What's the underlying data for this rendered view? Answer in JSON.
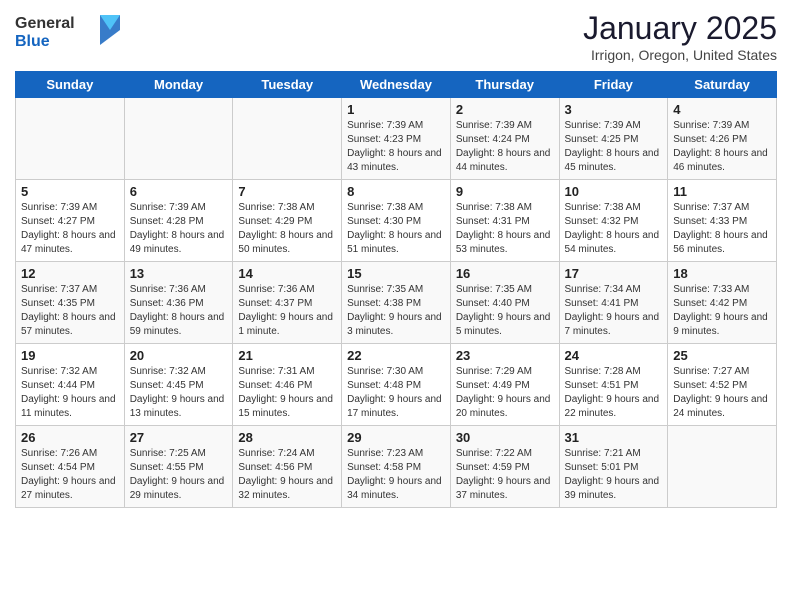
{
  "header": {
    "logo_general": "General",
    "logo_blue": "Blue",
    "month": "January 2025",
    "location": "Irrigon, Oregon, United States"
  },
  "days_of_week": [
    "Sunday",
    "Monday",
    "Tuesday",
    "Wednesday",
    "Thursday",
    "Friday",
    "Saturday"
  ],
  "weeks": [
    [
      {
        "day": "",
        "sunrise": "",
        "sunset": "",
        "daylight": "",
        "empty": true
      },
      {
        "day": "",
        "sunrise": "",
        "sunset": "",
        "daylight": "",
        "empty": true
      },
      {
        "day": "",
        "sunrise": "",
        "sunset": "",
        "daylight": "",
        "empty": true
      },
      {
        "day": "1",
        "sunrise": "Sunrise: 7:39 AM",
        "sunset": "Sunset: 4:23 PM",
        "daylight": "Daylight: 8 hours and 43 minutes."
      },
      {
        "day": "2",
        "sunrise": "Sunrise: 7:39 AM",
        "sunset": "Sunset: 4:24 PM",
        "daylight": "Daylight: 8 hours and 44 minutes."
      },
      {
        "day": "3",
        "sunrise": "Sunrise: 7:39 AM",
        "sunset": "Sunset: 4:25 PM",
        "daylight": "Daylight: 8 hours and 45 minutes."
      },
      {
        "day": "4",
        "sunrise": "Sunrise: 7:39 AM",
        "sunset": "Sunset: 4:26 PM",
        "daylight": "Daylight: 8 hours and 46 minutes."
      }
    ],
    [
      {
        "day": "5",
        "sunrise": "Sunrise: 7:39 AM",
        "sunset": "Sunset: 4:27 PM",
        "daylight": "Daylight: 8 hours and 47 minutes."
      },
      {
        "day": "6",
        "sunrise": "Sunrise: 7:39 AM",
        "sunset": "Sunset: 4:28 PM",
        "daylight": "Daylight: 8 hours and 49 minutes."
      },
      {
        "day": "7",
        "sunrise": "Sunrise: 7:38 AM",
        "sunset": "Sunset: 4:29 PM",
        "daylight": "Daylight: 8 hours and 50 minutes."
      },
      {
        "day": "8",
        "sunrise": "Sunrise: 7:38 AM",
        "sunset": "Sunset: 4:30 PM",
        "daylight": "Daylight: 8 hours and 51 minutes."
      },
      {
        "day": "9",
        "sunrise": "Sunrise: 7:38 AM",
        "sunset": "Sunset: 4:31 PM",
        "daylight": "Daylight: 8 hours and 53 minutes."
      },
      {
        "day": "10",
        "sunrise": "Sunrise: 7:38 AM",
        "sunset": "Sunset: 4:32 PM",
        "daylight": "Daylight: 8 hours and 54 minutes."
      },
      {
        "day": "11",
        "sunrise": "Sunrise: 7:37 AM",
        "sunset": "Sunset: 4:33 PM",
        "daylight": "Daylight: 8 hours and 56 minutes."
      }
    ],
    [
      {
        "day": "12",
        "sunrise": "Sunrise: 7:37 AM",
        "sunset": "Sunset: 4:35 PM",
        "daylight": "Daylight: 8 hours and 57 minutes."
      },
      {
        "day": "13",
        "sunrise": "Sunrise: 7:36 AM",
        "sunset": "Sunset: 4:36 PM",
        "daylight": "Daylight: 8 hours and 59 minutes."
      },
      {
        "day": "14",
        "sunrise": "Sunrise: 7:36 AM",
        "sunset": "Sunset: 4:37 PM",
        "daylight": "Daylight: 9 hours and 1 minute."
      },
      {
        "day": "15",
        "sunrise": "Sunrise: 7:35 AM",
        "sunset": "Sunset: 4:38 PM",
        "daylight": "Daylight: 9 hours and 3 minutes."
      },
      {
        "day": "16",
        "sunrise": "Sunrise: 7:35 AM",
        "sunset": "Sunset: 4:40 PM",
        "daylight": "Daylight: 9 hours and 5 minutes."
      },
      {
        "day": "17",
        "sunrise": "Sunrise: 7:34 AM",
        "sunset": "Sunset: 4:41 PM",
        "daylight": "Daylight: 9 hours and 7 minutes."
      },
      {
        "day": "18",
        "sunrise": "Sunrise: 7:33 AM",
        "sunset": "Sunset: 4:42 PM",
        "daylight": "Daylight: 9 hours and 9 minutes."
      }
    ],
    [
      {
        "day": "19",
        "sunrise": "Sunrise: 7:32 AM",
        "sunset": "Sunset: 4:44 PM",
        "daylight": "Daylight: 9 hours and 11 minutes."
      },
      {
        "day": "20",
        "sunrise": "Sunrise: 7:32 AM",
        "sunset": "Sunset: 4:45 PM",
        "daylight": "Daylight: 9 hours and 13 minutes."
      },
      {
        "day": "21",
        "sunrise": "Sunrise: 7:31 AM",
        "sunset": "Sunset: 4:46 PM",
        "daylight": "Daylight: 9 hours and 15 minutes."
      },
      {
        "day": "22",
        "sunrise": "Sunrise: 7:30 AM",
        "sunset": "Sunset: 4:48 PM",
        "daylight": "Daylight: 9 hours and 17 minutes."
      },
      {
        "day": "23",
        "sunrise": "Sunrise: 7:29 AM",
        "sunset": "Sunset: 4:49 PM",
        "daylight": "Daylight: 9 hours and 20 minutes."
      },
      {
        "day": "24",
        "sunrise": "Sunrise: 7:28 AM",
        "sunset": "Sunset: 4:51 PM",
        "daylight": "Daylight: 9 hours and 22 minutes."
      },
      {
        "day": "25",
        "sunrise": "Sunrise: 7:27 AM",
        "sunset": "Sunset: 4:52 PM",
        "daylight": "Daylight: 9 hours and 24 minutes."
      }
    ],
    [
      {
        "day": "26",
        "sunrise": "Sunrise: 7:26 AM",
        "sunset": "Sunset: 4:54 PM",
        "daylight": "Daylight: 9 hours and 27 minutes."
      },
      {
        "day": "27",
        "sunrise": "Sunrise: 7:25 AM",
        "sunset": "Sunset: 4:55 PM",
        "daylight": "Daylight: 9 hours and 29 minutes."
      },
      {
        "day": "28",
        "sunrise": "Sunrise: 7:24 AM",
        "sunset": "Sunset: 4:56 PM",
        "daylight": "Daylight: 9 hours and 32 minutes."
      },
      {
        "day": "29",
        "sunrise": "Sunrise: 7:23 AM",
        "sunset": "Sunset: 4:58 PM",
        "daylight": "Daylight: 9 hours and 34 minutes."
      },
      {
        "day": "30",
        "sunrise": "Sunrise: 7:22 AM",
        "sunset": "Sunset: 4:59 PM",
        "daylight": "Daylight: 9 hours and 37 minutes."
      },
      {
        "day": "31",
        "sunrise": "Sunrise: 7:21 AM",
        "sunset": "Sunset: 5:01 PM",
        "daylight": "Daylight: 9 hours and 39 minutes."
      },
      {
        "day": "",
        "sunrise": "",
        "sunset": "",
        "daylight": "",
        "empty": true
      }
    ]
  ]
}
